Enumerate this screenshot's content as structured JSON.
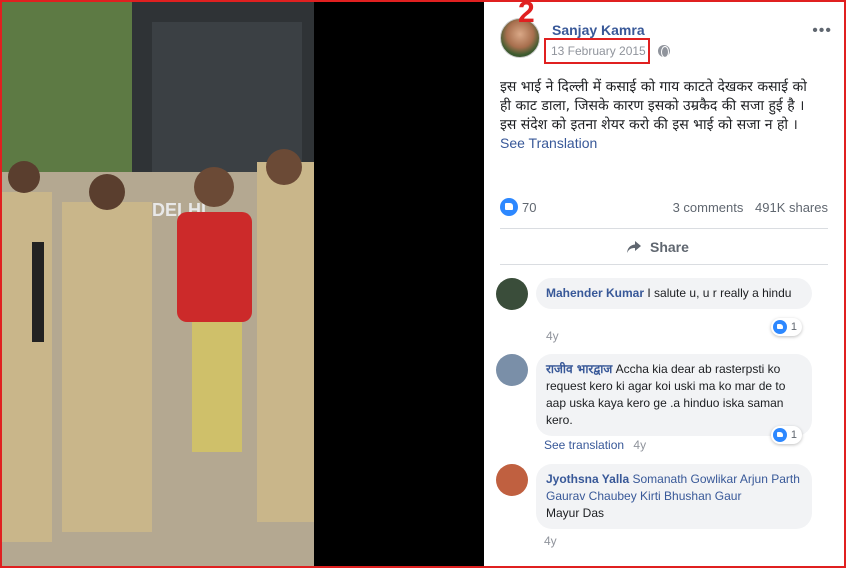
{
  "annotation": {
    "marker": "2"
  },
  "post": {
    "author": "Sanjay Kamra",
    "date": "13 February 2015",
    "more_label": "•••",
    "text_lines": [
      "इस भाई ने दिल्ली में कसाई को गाय काटते देखकर कसाई को",
      "ही काट डाला, जिसके कारण इसको उम्रकैद की सजा हुई है ।",
      "इस संदेश को इतना शेयर करो की इस भाई को सजा न हो ।"
    ],
    "see_translation": "See Translation",
    "reaction_count": "70",
    "comments_count": "3 comments",
    "shares_count": "491K shares",
    "share_label": "Share",
    "photo_text": "DELHI"
  },
  "comments": [
    {
      "name": "Mahender Kumar",
      "text": "I salute u, u r really a hindu",
      "time": "4y",
      "reactions": "1",
      "avatar_color": "#3a4d3a"
    },
    {
      "name": "राजीव भारद्वाज",
      "text": "Accha kia dear ab rasterpsti ko request kero ki agar koi uski ma ko mar de to aap uska kaya kero ge .a hinduo iska saman kero.",
      "see_translation": "See translation",
      "time": "4y",
      "reactions": "1",
      "avatar_color": "#7a8fa8"
    },
    {
      "name": "Jyothsna Yalla",
      "tags": "Somanath Gowlikar Arjun Parth Gaurav Chaubey Kirti Bhushan Gaur",
      "text": "Mayur Das",
      "time": "4y",
      "avatar_color": "#c06040"
    }
  ],
  "colors": {
    "annotation_red": "#e02020",
    "link_blue": "#385898",
    "like_blue": "#2d88ff",
    "meta_gray": "#90949c"
  }
}
